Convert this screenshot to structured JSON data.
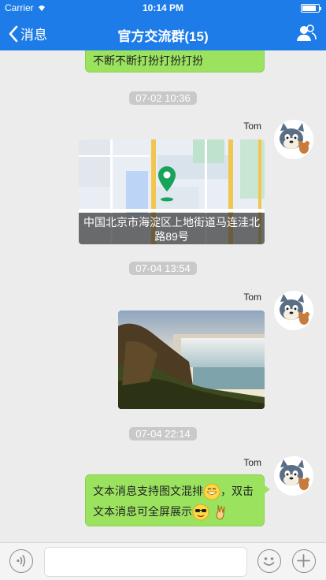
{
  "status_bar": {
    "carrier": "Carrier",
    "time": "10:14 PM",
    "battery_level": 0.85
  },
  "nav": {
    "back_label": "消息",
    "title": "官方交流群(15)",
    "group_icon": "group-members-icon"
  },
  "messages": {
    "top_bubble": {
      "text": "都很不方便本地坐不断不断不断不断不断打扮打扮打扮"
    },
    "ts1": "07-02 10:36",
    "loc": {
      "sender": "Tom",
      "address": "中国北京市海淀区上地街道马连洼北路89号"
    },
    "ts2": "07-04 13:54",
    "img": {
      "sender": "Tom"
    },
    "ts3": "07-04 22:14",
    "text": {
      "sender": "Tom",
      "line1": "文本消息支持图文混排",
      "line1_after": "，双击",
      "line2": "文本消息可全屏展示"
    }
  },
  "input_bar": {
    "value": "",
    "placeholder": ""
  },
  "colors": {
    "accent": "#1e7ce8",
    "bubble": "#9be35f",
    "timestamp_bg": "#c9c9c9",
    "background": "#ececec"
  }
}
